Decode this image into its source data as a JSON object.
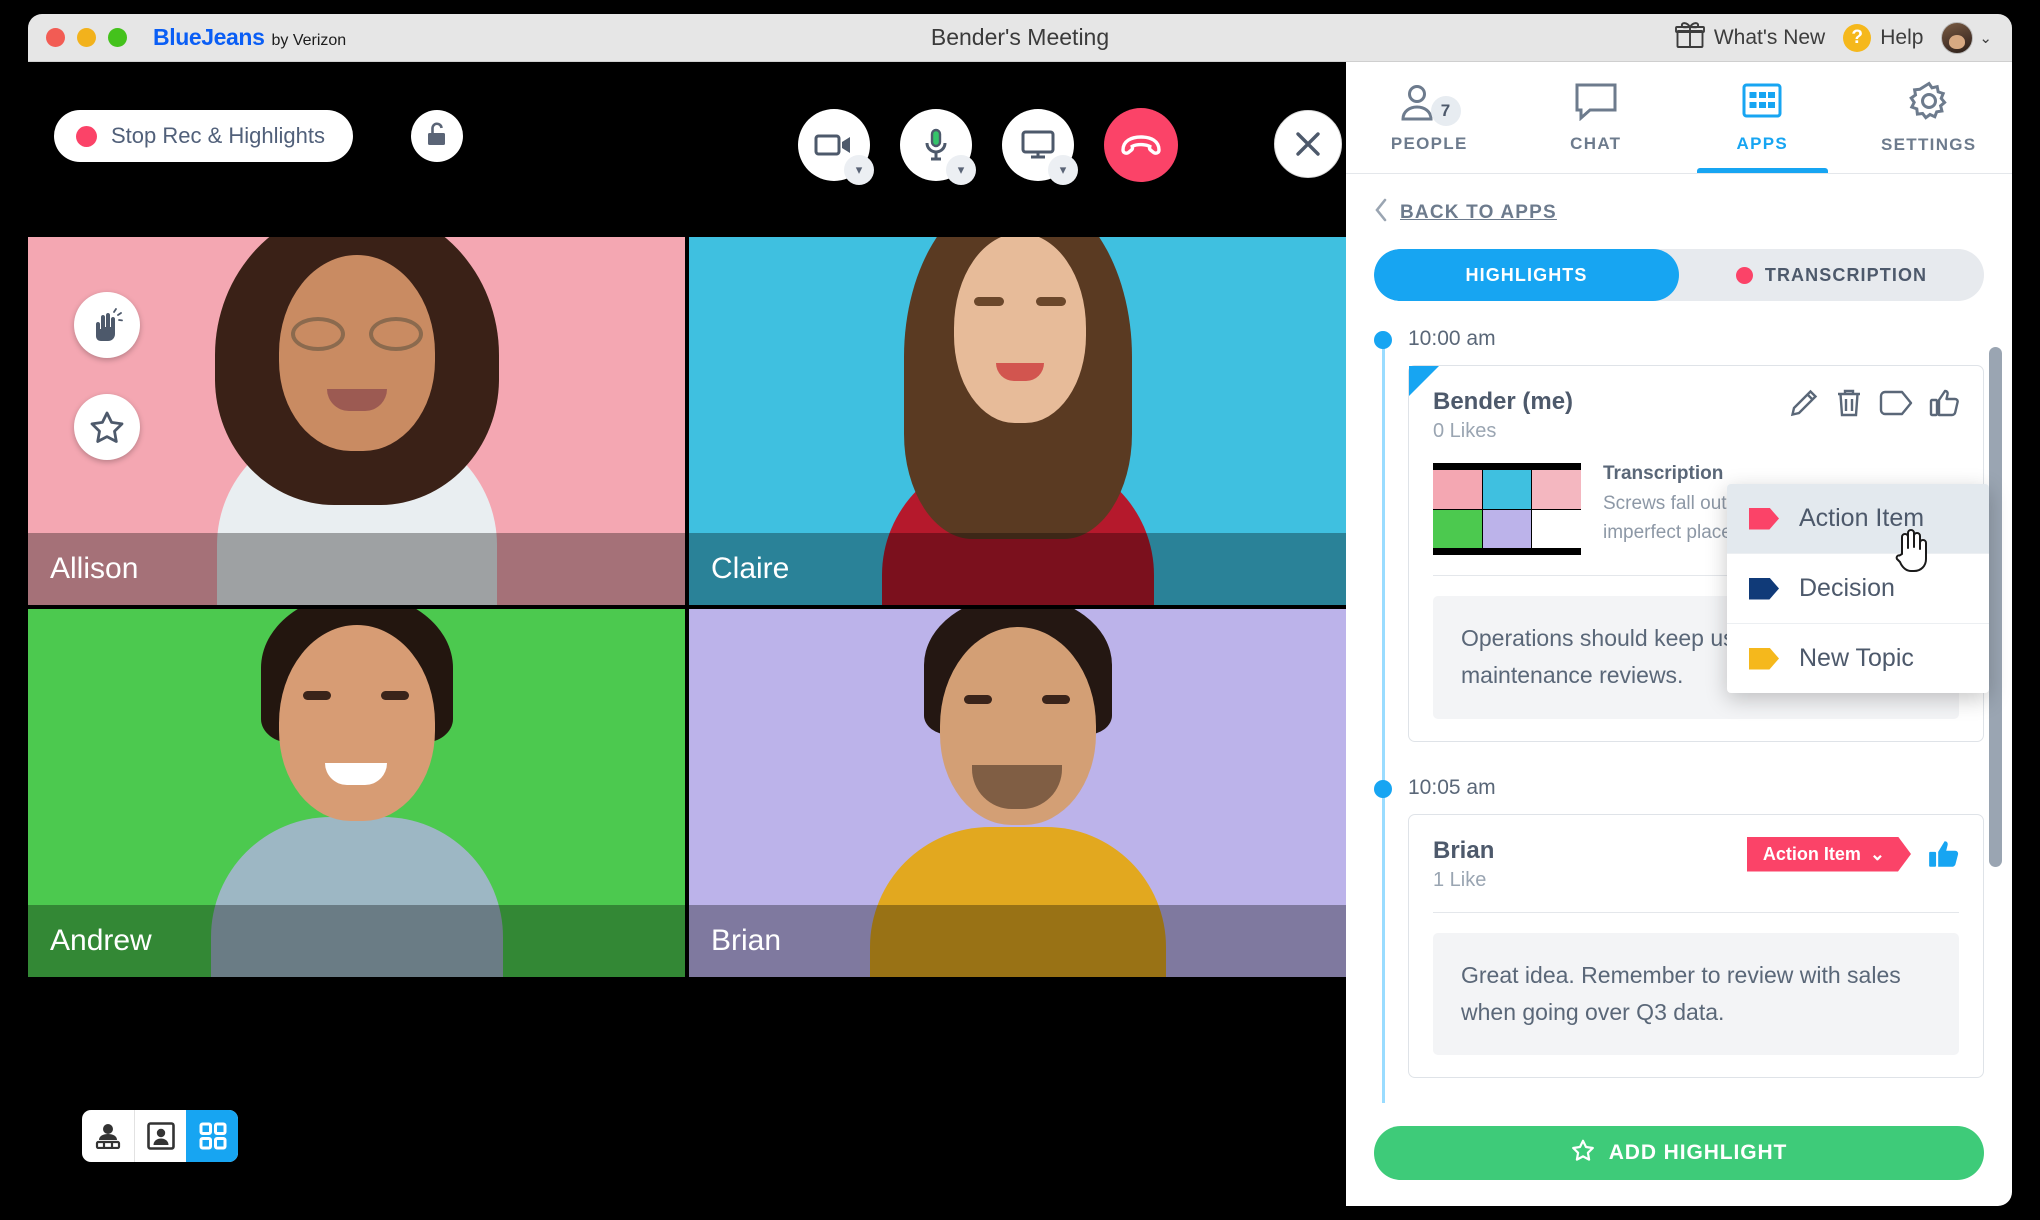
{
  "window": {
    "title": "Bender's Meeting",
    "brand_primary": "BlueJeans",
    "brand_secondary": "by Verizon",
    "whats_new": "What's New",
    "help": "Help",
    "help_glyph": "?",
    "chevron": "⌄"
  },
  "stage": {
    "record_label": "Stop Rec & Highlights",
    "controls": [
      {
        "name": "camera",
        "caret": true
      },
      {
        "name": "microphone",
        "caret": true
      },
      {
        "name": "screen-share",
        "caret": true
      },
      {
        "name": "hangup",
        "caret": false
      }
    ],
    "participants": [
      {
        "name": "Allison",
        "bg": "#f4a7b2",
        "hair": "#3a2117",
        "skin": "#c98b62",
        "shirt": "#e9eef1"
      },
      {
        "name": "Claire",
        "bg": "#3fc0e0",
        "hair": "#5a3a22",
        "skin": "#e7bb99",
        "shirt": "#b5192c"
      },
      {
        "name": "Andrew",
        "bg": "#4cc94f",
        "hair": "#23160f",
        "skin": "#d79c74",
        "shirt": "#9db7c4"
      },
      {
        "name": "Brian",
        "bg": "#bcb3ea",
        "hair": "#241712",
        "skin": "#d39f75",
        "shirt": "#e2a81f"
      }
    ],
    "layout_modes": [
      "speaker-view",
      "people-view",
      "grid-view"
    ],
    "active_layout": "grid-view",
    "float_buttons": [
      "raise-hand",
      "star"
    ]
  },
  "panel": {
    "tabs": [
      {
        "label": "PEOPLE",
        "icon": "people-icon",
        "badge": "7",
        "active": false
      },
      {
        "label": "CHAT",
        "icon": "chat-icon",
        "badge": null,
        "active": false
      },
      {
        "label": "APPS",
        "icon": "apps-icon",
        "badge": null,
        "active": true
      },
      {
        "label": "SETTINGS",
        "icon": "gear-icon",
        "badge": null,
        "active": false
      }
    ],
    "back_link": "BACK TO APPS",
    "segments": [
      {
        "label": "HIGHLIGHTS",
        "active": true,
        "dot": false
      },
      {
        "label": "TRANSCRIPTION",
        "active": false,
        "dot": true
      }
    ],
    "highlights": [
      {
        "time": "10:00 am",
        "author": "Bender (me)",
        "likes": "0 Likes",
        "flagged": true,
        "actions": [
          "edit-icon",
          "delete-icon",
          "tag-icon",
          "like-icon"
        ],
        "transcription_title": "Transcription",
        "transcription_body": "Screws fall out all the time, the world is an imperfect place.",
        "quote": "Operations should keep using highlights in maintenance reviews."
      },
      {
        "time": "10:05 am",
        "author": "Brian",
        "likes": "1 Like",
        "flagged": false,
        "tag": "Action Item",
        "tag_caret": "⌄",
        "liked": true,
        "quote": "Great idea. Remember to review with sales when going over Q3 data."
      }
    ],
    "tag_menu": {
      "items": [
        {
          "label": "Action Item",
          "color": "#fb4368",
          "highlighted": true
        },
        {
          "label": "Decision",
          "color": "#103a78",
          "highlighted": false
        },
        {
          "label": "New Topic",
          "color": "#f5b81c",
          "highlighted": false
        }
      ]
    },
    "add_highlight": "ADD HIGHLIGHT"
  },
  "colors": {
    "accent_blue": "#17a5f2",
    "accent_pink": "#fb4368",
    "accent_green": "#3ecb79",
    "text_slate": "#4d596b"
  }
}
